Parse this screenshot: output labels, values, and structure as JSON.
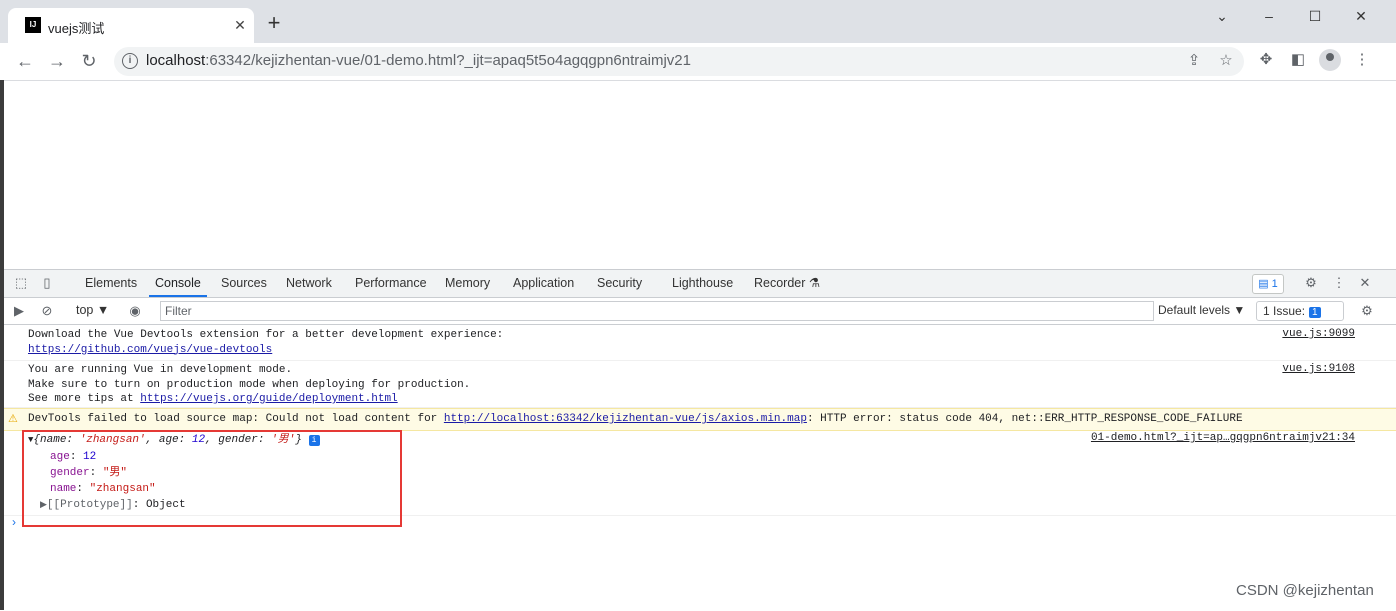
{
  "browser": {
    "tab_title": "vuejs测试",
    "favicon_text": "IJ",
    "tab_close": "✕",
    "new_tab": "+",
    "window_controls": {
      "dropdown": "⌄",
      "minimize": "–",
      "maximize": "☐",
      "close": "✕"
    },
    "url_host": "localhost",
    "url_rest": ":63342/kejizhentan-vue/01-demo.html?_ijt=apaq5t5o4agqgpn6ntraimjv21"
  },
  "devtools": {
    "tabs": [
      "Elements",
      "Console",
      "Sources",
      "Network",
      "Performance",
      "Memory",
      "Application",
      "Security",
      "Lighthouse",
      "Recorder"
    ],
    "active_tab": "Console",
    "issues_badge": "1",
    "context": "top ▼",
    "filter_placeholder": "Filter",
    "levels": "Default levels ▼",
    "issues_label": "1 Issue:",
    "issues_count": "1"
  },
  "console": {
    "msg1_line1": "Download the Vue Devtools extension for a better development experience:",
    "msg1_link": "https://github.com/vuejs/vue-devtools",
    "msg1_source": "vue.js:9099",
    "msg2_line1": "You are running Vue in development mode.",
    "msg2_line2": "Make sure to turn on production mode when deploying for production.",
    "msg2_line3_prefix": "See more tips at ",
    "msg2_link": "https://vuejs.org/guide/deployment.html",
    "msg2_source": "vue.js:9108",
    "warn_prefix": "DevTools failed to load source map: Could not load content for ",
    "warn_link": "http://localhost:63342/kejizhentan-vue/js/axios.min.map",
    "warn_suffix": ": HTTP error: status code 404, net::ERR_HTTP_RESPONSE_CODE_FAILURE",
    "obj_source": "01-demo.html?_ijt=ap…gqgpn6ntraimjv21:34",
    "obj_preview": {
      "open": "{",
      "name_key": "name: ",
      "name_val": "'zhangsan'",
      "age_key": ", age: ",
      "age_val": "12",
      "gender_key": ", gender: ",
      "gender_val": "'男'",
      "close": "}"
    },
    "props": [
      {
        "key": "age",
        "value": "12"
      },
      {
        "key": "gender",
        "value": "\"男\""
      },
      {
        "key": "name",
        "value": "\"zhangsan\""
      }
    ],
    "prototype": "[[Prototype]]",
    "prototype_val": "Object"
  },
  "watermark": "CSDN @kejizhentan",
  "colors": {
    "accent": "#1a73e8",
    "highlight_box": "#e53935",
    "warning_bg": "#fefbe5"
  }
}
